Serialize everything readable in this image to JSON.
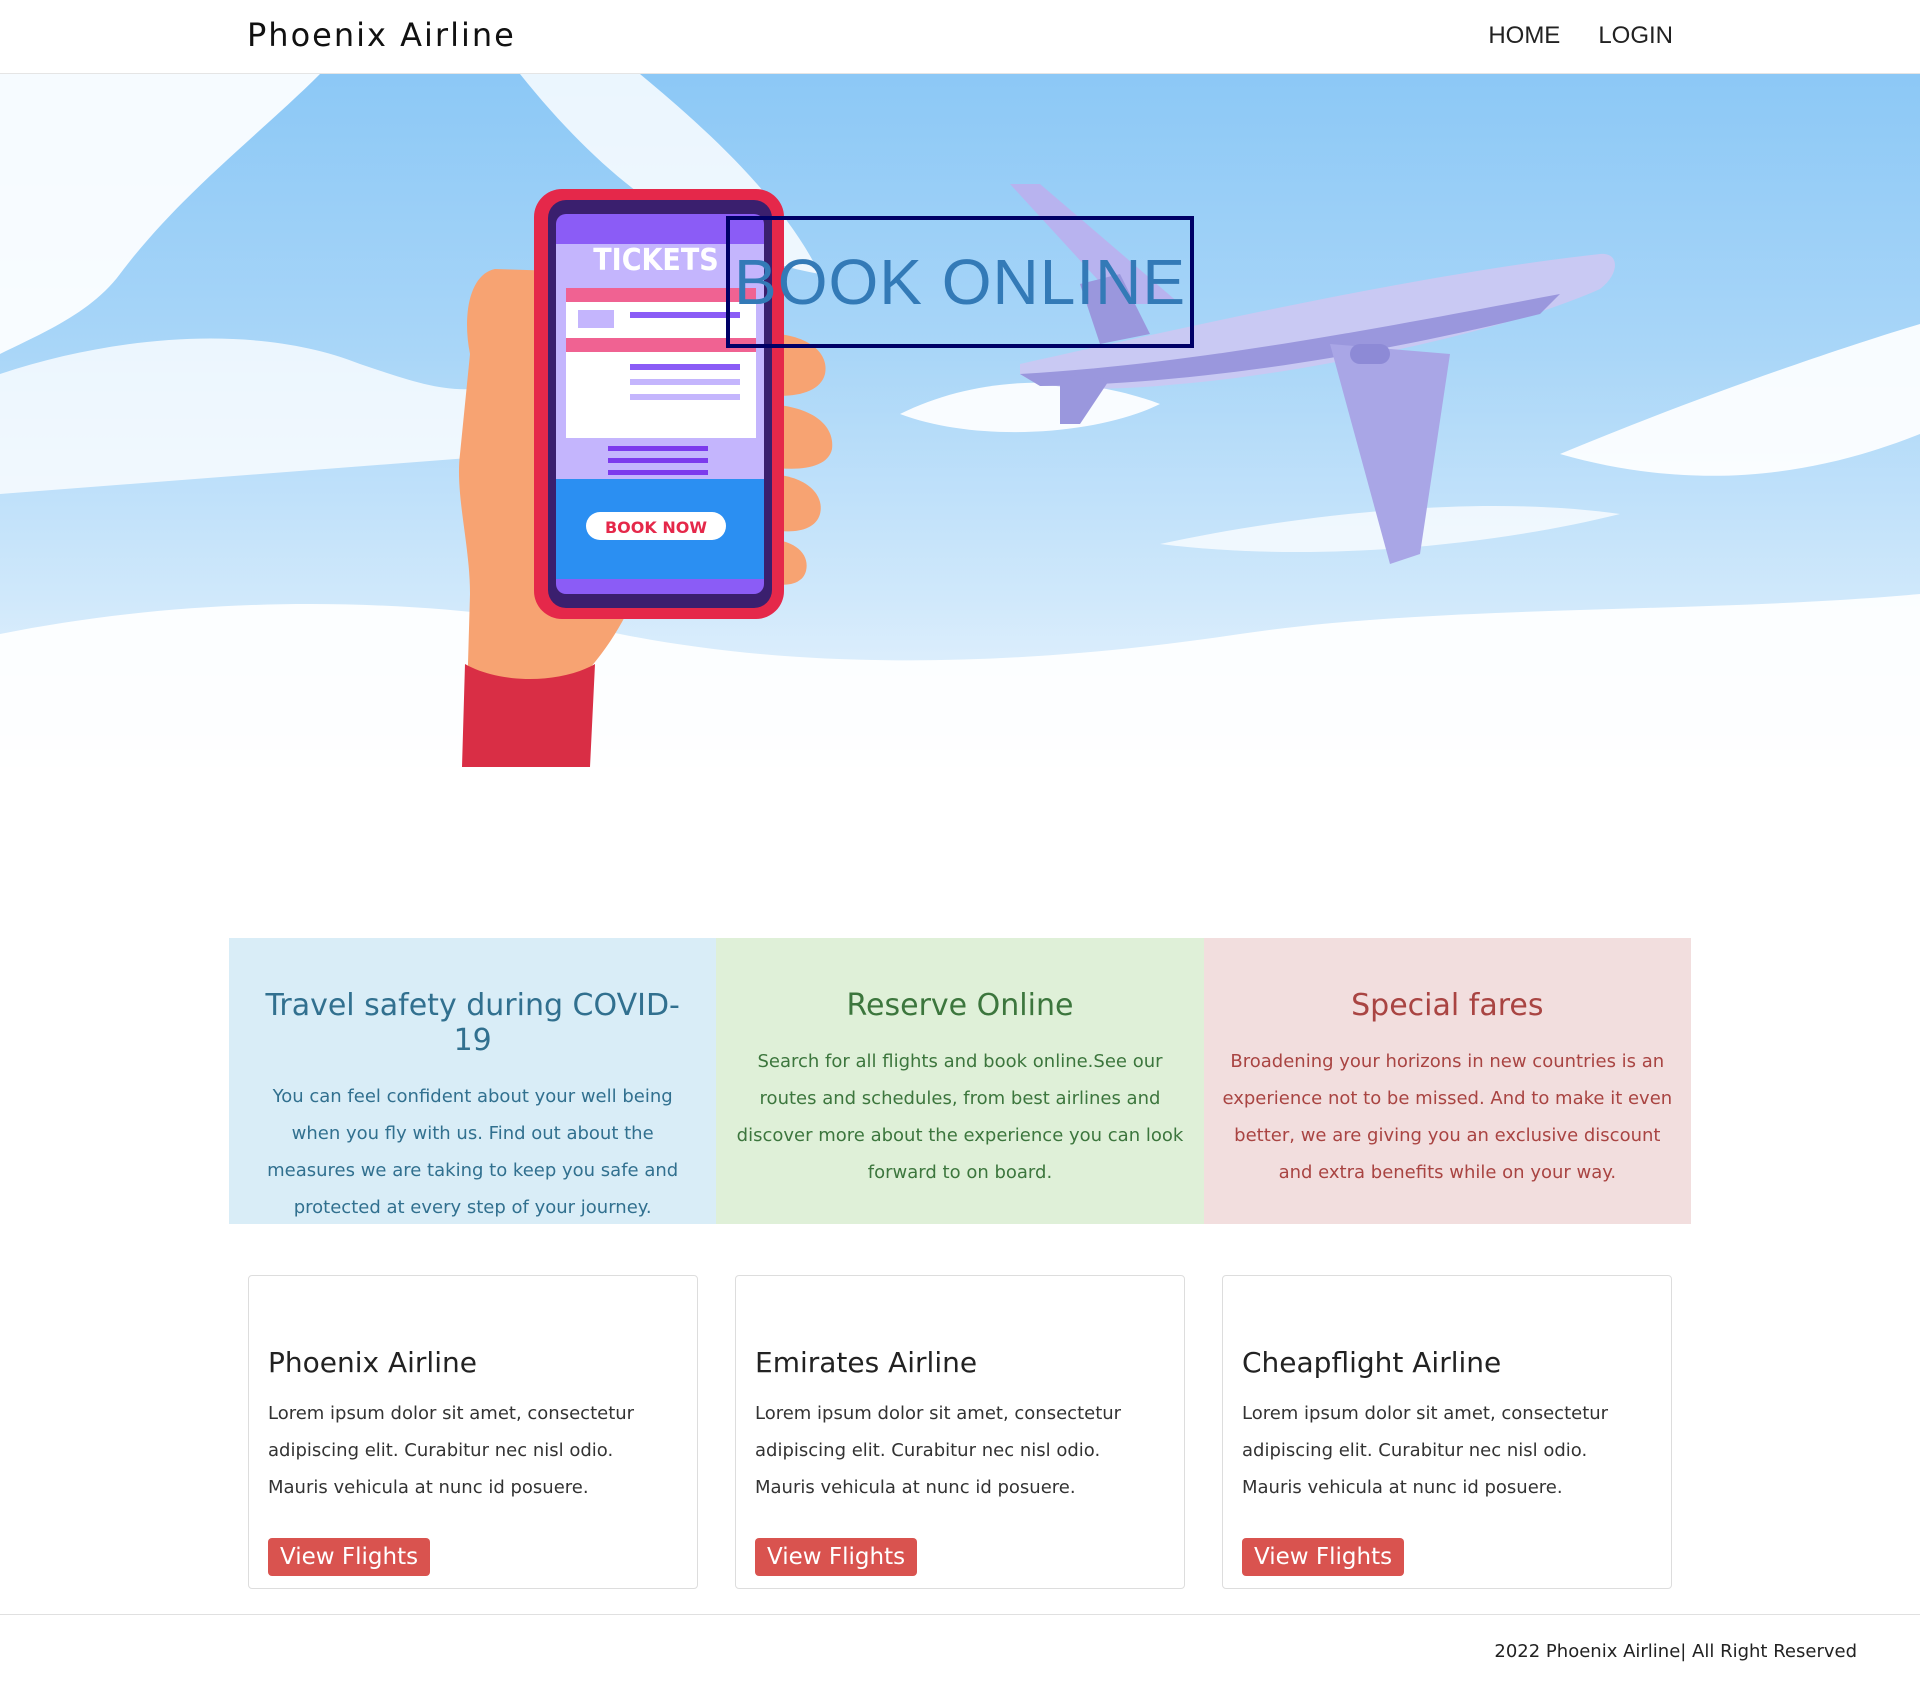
{
  "navbar": {
    "brand": "Phoenix Airline",
    "links": [
      "HOME",
      "LOGIN"
    ]
  },
  "hero": {
    "title": "BOOK ONLINE",
    "phone_header": "TICKETS",
    "phone_button": "BOOK NOW",
    "colors": {
      "sky": "#8cc8f6",
      "title": "#337ab7",
      "box_border": "#000066"
    }
  },
  "panels": [
    {
      "title": "Travel safety during COVID-19",
      "text": "You can feel confident about your well being when you fly with us. Find out about the measures we are taking to keep you safe and protected at every step of your journey."
    },
    {
      "title": "Reserve Online",
      "text": "Search for all flights and book online.See our routes and schedules, from best airlines and discover more about the experience you can look forward to on board."
    },
    {
      "title": "Special fares",
      "text": "Broadening your horizons in new countries is an experience not to be missed. And to make it even better, we are giving you an exclusive discount and extra benefits while on your way."
    }
  ],
  "cards": [
    {
      "title": "Phoenix Airline",
      "text": "Lorem ipsum dolor sit amet, consectetur adipiscing elit. Curabitur nec nisl odio. Mauris vehicula at nunc id posuere.",
      "button": "View Flights"
    },
    {
      "title": "Emirates Airline",
      "text": "Lorem ipsum dolor sit amet, consectetur adipiscing elit. Curabitur nec nisl odio. Mauris vehicula at nunc id posuere.",
      "button": "View Flights"
    },
    {
      "title": "Cheapflight Airline",
      "text": "Lorem ipsum dolor sit amet, consectetur adipiscing elit. Curabitur nec nisl odio. Mauris vehicula at nunc id posuere.",
      "button": "View Flights"
    }
  ],
  "footer": {
    "text": "2022 Phoenix Airline| All Right Reserved"
  }
}
